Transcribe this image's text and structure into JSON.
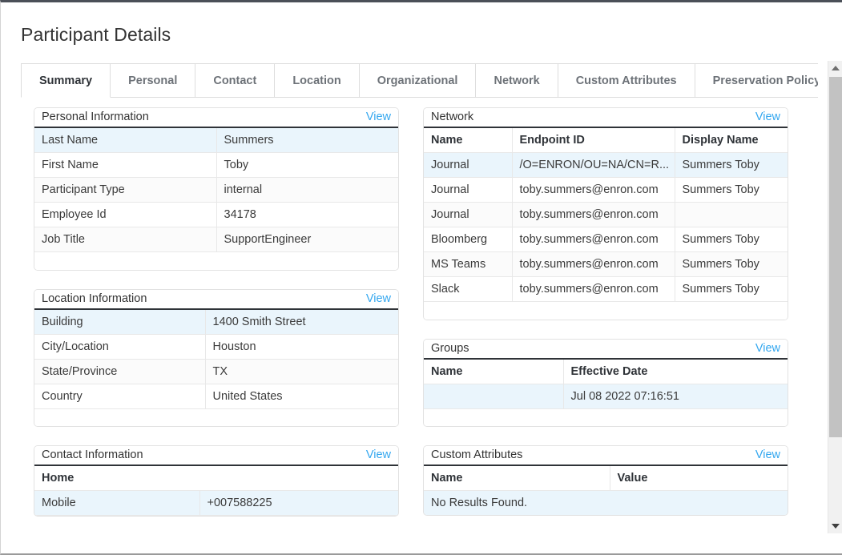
{
  "page": {
    "title": "Participant Details"
  },
  "tabs": [
    {
      "label": "Summary",
      "active": true
    },
    {
      "label": "Personal",
      "active": false
    },
    {
      "label": "Contact",
      "active": false
    },
    {
      "label": "Location",
      "active": false
    },
    {
      "label": "Organizational",
      "active": false
    },
    {
      "label": "Network",
      "active": false
    },
    {
      "label": "Custom Attributes",
      "active": false
    },
    {
      "label": "Preservation Policy",
      "active": false
    }
  ],
  "common": {
    "view_label": "View"
  },
  "colors": {
    "link": "#34a7ef",
    "row_highlight": "#eaf5fc",
    "row_alt": "#fbfbfb",
    "header_rule": "#2f3338",
    "panel_border": "#e2e2e2",
    "scrollbar_thumb": "#c2c2c2"
  },
  "panels": {
    "personal_information": {
      "title": "Personal Information",
      "view_label": "View",
      "rows": [
        {
          "label": "Last Name",
          "value": "Summers"
        },
        {
          "label": "First Name",
          "value": "Toby"
        },
        {
          "label": "Participant Type",
          "value": "internal"
        },
        {
          "label": "Employee Id",
          "value": "34178"
        },
        {
          "label": "Job Title",
          "value": "SupportEngineer"
        }
      ]
    },
    "location_information": {
      "title": "Location Information",
      "view_label": "View",
      "rows": [
        {
          "label": "Building",
          "value": "1400 Smith Street"
        },
        {
          "label": "City/Location",
          "value": "Houston"
        },
        {
          "label": "State/Province",
          "value": "TX"
        },
        {
          "label": "Country",
          "value": "United States"
        }
      ]
    },
    "contact_information": {
      "title": "Contact Information",
      "view_label": "View",
      "group_label": "Home",
      "rows": [
        {
          "label": "Mobile",
          "value": "+007588225"
        }
      ]
    },
    "network": {
      "title": "Network",
      "view_label": "View",
      "columns": [
        "Name",
        "Endpoint ID",
        "Display Name"
      ],
      "rows": [
        {
          "name": "Journal",
          "endpoint_id": "/O=ENRON/OU=NA/CN=R...",
          "display_name": "Summers Toby"
        },
        {
          "name": "Journal",
          "endpoint_id": "toby.summers@enron.com",
          "display_name": "Summers Toby"
        },
        {
          "name": "Journal",
          "endpoint_id": "toby.summers@enron.com",
          "display_name": ""
        },
        {
          "name": "Bloomberg",
          "endpoint_id": "toby.summers@enron.com",
          "display_name": "Summers Toby"
        },
        {
          "name": "MS Teams",
          "endpoint_id": "toby.summers@enron.com",
          "display_name": "Summers Toby"
        },
        {
          "name": "Slack",
          "endpoint_id": "toby.summers@enron.com",
          "display_name": "Summers Toby"
        }
      ]
    },
    "groups": {
      "title": "Groups",
      "view_label": "View",
      "columns": [
        "Name",
        "Effective Date"
      ],
      "rows": [
        {
          "name": "",
          "effective_date": "Jul 08 2022 07:16:51"
        }
      ]
    },
    "custom_attributes": {
      "title": "Custom Attributes",
      "view_label": "View",
      "columns": [
        "Name",
        "Value"
      ],
      "empty_message": "No Results Found."
    }
  }
}
